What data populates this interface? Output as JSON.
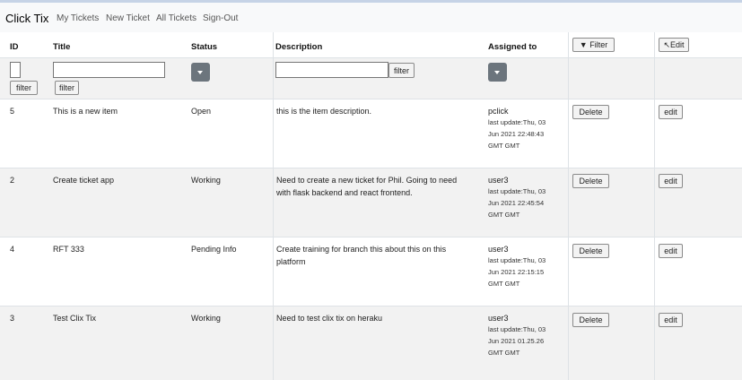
{
  "nav": {
    "brand": "Click Tix",
    "links": [
      "My Tickets",
      "New Ticket",
      "All Tickets",
      "Sign-Out"
    ]
  },
  "columns": {
    "id": "ID",
    "title": "Title",
    "status": "Status",
    "description": "Description",
    "assigned": "Assigned to",
    "filter_btn": "Filter",
    "edit_btn": "Edit"
  },
  "filters": {
    "filter_label": "filter"
  },
  "rows": [
    {
      "id": "5",
      "title": "This is a new item",
      "status": "Open",
      "description": "this is the item description.",
      "assigned": "pclick",
      "last_update": "last update:Thu, 03",
      "last_update_2": "Jun 2021 22:48:43",
      "last_update_3": "GMT GMT",
      "delete": "Delete",
      "edit": "edit"
    },
    {
      "id": "2",
      "title": "Create ticket app",
      "status": "Working",
      "description": "Need to create a new ticket for Phil. Going to need",
      "description_2": "with flask backend and react frontend.",
      "assigned": "user3",
      "last_update": "last update:Thu, 03",
      "last_update_2": "Jun 2021 22:45:54",
      "last_update_3": "GMT GMT",
      "delete": "Delete",
      "edit": "edit"
    },
    {
      "id": "4",
      "title": "RFT 333",
      "status": "Pending Info",
      "description": "Create training for branch this about this on this",
      "description_2": "platform",
      "assigned": "user3",
      "last_update": "last update:Thu, 03",
      "last_update_2": "Jun 2021 22:15:15",
      "last_update_3": "GMT GMT",
      "delete": "Delete",
      "edit": "edit"
    },
    {
      "id": "3",
      "title": "Test Clix Tix",
      "status": "Working",
      "description": "Need to test clix tix on heraku",
      "assigned": "user3",
      "last_update": "last update:Thu, 03",
      "last_update_2": "Jun 2021 01.25.26",
      "last_update_3": "GMT GMT",
      "delete": "Delete",
      "edit": "edit"
    }
  ]
}
